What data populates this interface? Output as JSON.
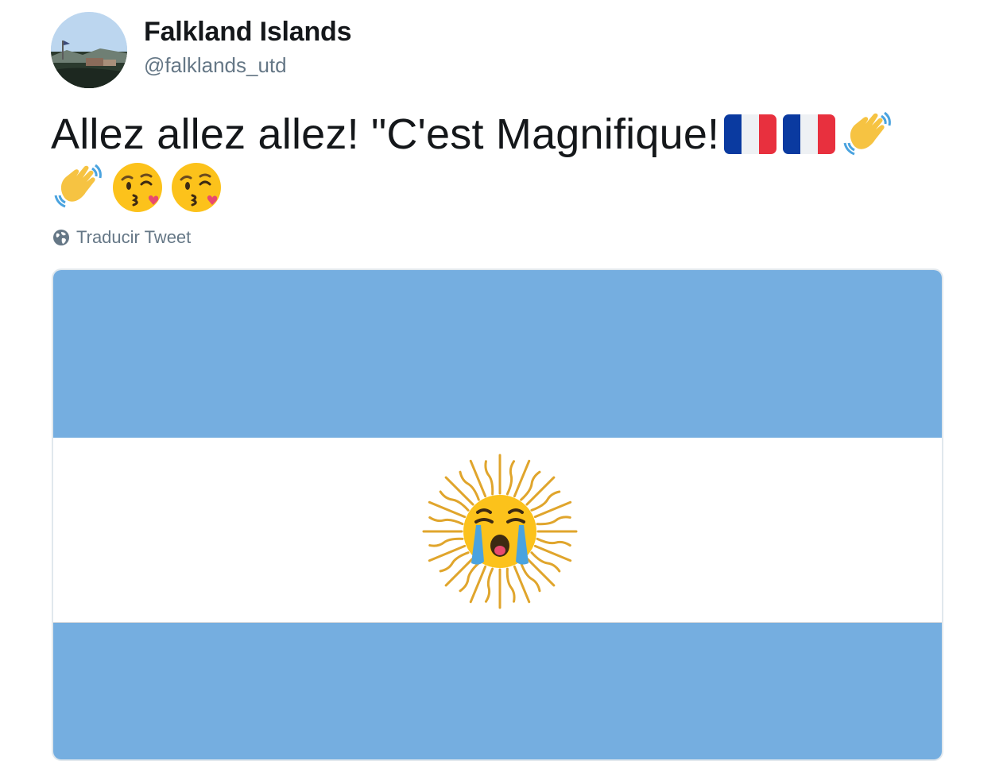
{
  "tweet": {
    "author": {
      "display_name": "Falkland Islands",
      "handle": "@falklands_utd",
      "avatar_icon": "avatar-photo-icon"
    },
    "text_line_1": "Allez allez allez! \"C'est Magnifique! ",
    "emojis_line_1": [
      "france-flag-icon",
      "france-flag-icon",
      "waving-hand-icon"
    ],
    "emojis_line_2": [
      "waving-hand-icon",
      "kissing-face-icon",
      "kissing-face-icon"
    ],
    "translate_label": "Traducir Tweet",
    "media": {
      "description_icon": "argentina-flag-crying-sun-icon",
      "colors": {
        "sky_blue": "#75aee0",
        "white": "#ffffff",
        "sun_gold": "#e0a52c"
      }
    }
  },
  "colors": {
    "text_primary": "#14171a",
    "text_secondary": "#657786",
    "border": "#e1e8ed"
  }
}
